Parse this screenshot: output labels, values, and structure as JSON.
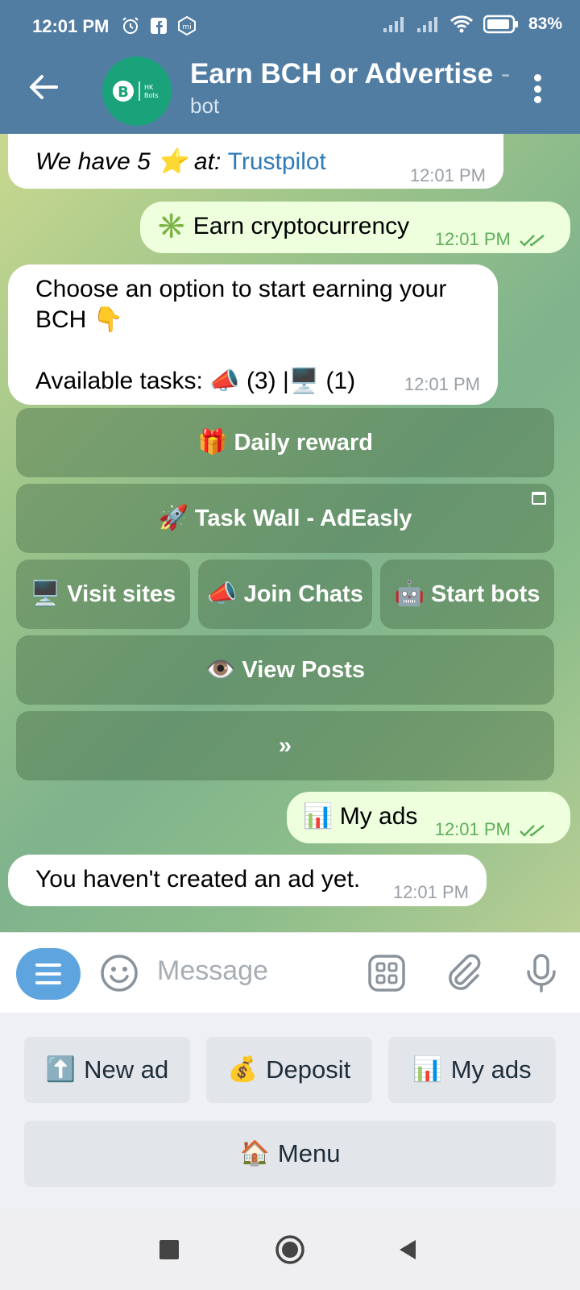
{
  "status": {
    "time": "12:01 PM",
    "battery": "83%"
  },
  "header": {
    "title": "Earn BCH or Advertise",
    "title_fade": "-",
    "subtitle": "bot",
    "avatar_text": "HK Bots"
  },
  "messages": {
    "m1_text_italic": "We have 5",
    "m1_text_italic2": "at:",
    "m1_link": "Trustpilot",
    "m1_time": "12:01 PM",
    "m2_text": "Earn cryptocurrency",
    "m2_time": "12:01 PM",
    "m3_line1": "Choose an option to start earning your",
    "m3_line2": "BCH",
    "m3_line3": "Available tasks:",
    "m3_count1": "(3) |",
    "m3_count2": "(1)",
    "m3_time": "12:01 PM",
    "m4_text": "My ads",
    "m4_time": "12:01 PM",
    "m5_text": "You haven't created an ad yet.",
    "m5_time": "12:01 PM"
  },
  "inline_keyboard": {
    "daily_reward": "Daily reward",
    "task_wall": "Task Wall - AdEasly",
    "visit_sites": "Visit sites",
    "join_chats": "Join Chats",
    "start_bots": "Start bots",
    "view_posts": "View Posts",
    "next": "»"
  },
  "input": {
    "placeholder": "Message"
  },
  "reply_keyboard": {
    "new_ad": "New ad",
    "deposit": "Deposit",
    "my_ads": "My ads",
    "menu": "Menu"
  },
  "colors": {
    "header": "#527da3",
    "accent": "#5ea5e0",
    "outgoing": "#eeffde",
    "link": "#2f7bb5"
  }
}
